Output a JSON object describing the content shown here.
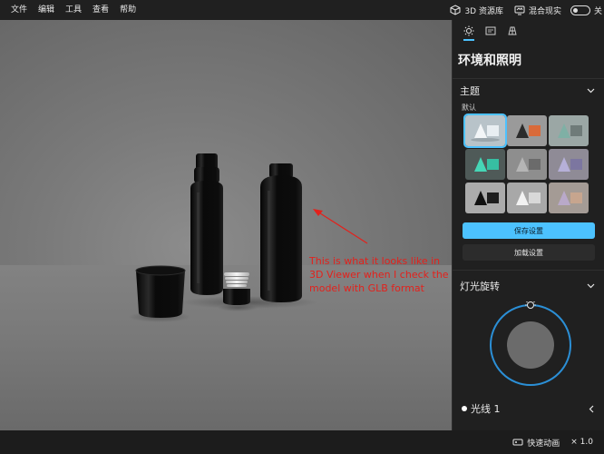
{
  "menu": {
    "items": [
      "文件",
      "编辑",
      "工具",
      "查看",
      "帮助"
    ]
  },
  "topbar": {
    "library_label": "3D 资源库",
    "mixed_reality_label": "混合现实",
    "toggle_state_label": "关"
  },
  "viewport": {
    "annotation": "This is what it looks like in 3D Viewer when I check the model with GLB format"
  },
  "panel": {
    "title": "环境和照明",
    "theme_section": "主题",
    "default_label": "默认",
    "themes": [
      {
        "name": "theme-1",
        "bg": "#b7c2c8",
        "selected": true
      },
      {
        "name": "theme-2",
        "bg": "#9a9a9a",
        "selected": false
      },
      {
        "name": "theme-3",
        "bg": "#9aa6a4",
        "selected": false
      },
      {
        "name": "theme-4",
        "bg": "#4f5a58",
        "selected": false
      },
      {
        "name": "theme-5",
        "bg": "#8e8e8e",
        "selected": false
      },
      {
        "name": "theme-6",
        "bg": "#8f8b96",
        "selected": false
      },
      {
        "name": "theme-7",
        "bg": "#ababab",
        "selected": false
      },
      {
        "name": "theme-8",
        "bg": "#a8a8a8",
        "selected": false
      },
      {
        "name": "theme-9",
        "bg": "#a49b95",
        "selected": false
      }
    ],
    "save_label": "保存设置",
    "load_label": "加载设置",
    "light_rotation_section": "灯光旋转",
    "light_item_label": "光线 1",
    "accent": "#4cc2ff"
  },
  "status": {
    "animation_label": "快速动画",
    "speed_label": "× 1.0"
  }
}
